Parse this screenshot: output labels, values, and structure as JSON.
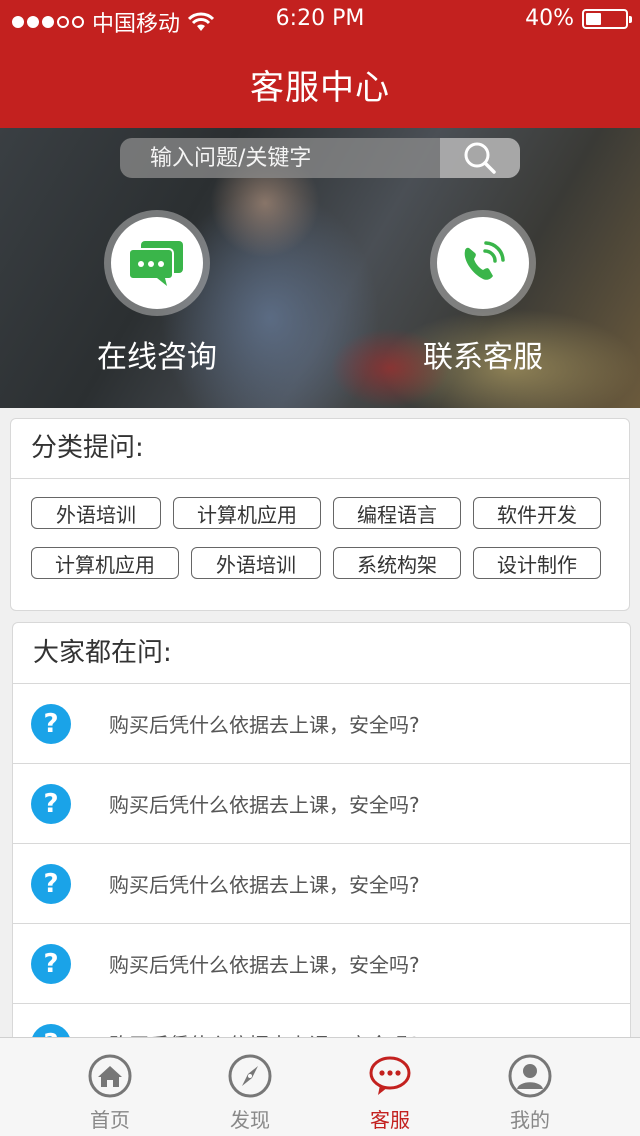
{
  "status_bar": {
    "carrier": "中国移动",
    "time": "6:20 PM",
    "battery_text": "40%",
    "battery_level": 0.4
  },
  "header": {
    "title": "客服中心"
  },
  "search": {
    "placeholder": "输入问题/关键字",
    "icon": "search-icon"
  },
  "actions": [
    {
      "label": "在线咨询",
      "icon": "chat-icon",
      "color": "#3ab54a"
    },
    {
      "label": "联系客服",
      "icon": "phone-icon",
      "color": "#3ab54a"
    }
  ],
  "categories": {
    "title": "分类提问:",
    "rows": [
      [
        "外语培训",
        "计算机应用",
        "编程语言",
        "软件开发"
      ],
      [
        "计算机应用",
        "外语培训",
        "系统构架",
        "设计制作"
      ]
    ]
  },
  "faq": {
    "title": "大家都在问:",
    "items": [
      "购买后凭什么依据去上课，安全吗?",
      "购买后凭什么依据去上课，安全吗?",
      "购买后凭什么依据去上课，安全吗?",
      "购买后凭什么依据去上课，安全吗?",
      "购买后凭什么依据去上课，安全吗?"
    ],
    "icon_color": "#1aa3e8"
  },
  "tabbar": {
    "items": [
      {
        "label": "首页",
        "icon": "home-icon",
        "active": false
      },
      {
        "label": "发现",
        "icon": "compass-icon",
        "active": false
      },
      {
        "label": "客服",
        "icon": "chat-bubble-icon",
        "active": true
      },
      {
        "label": "我的",
        "icon": "user-icon",
        "active": false
      }
    ],
    "active_color": "#c3211f"
  },
  "colors": {
    "brand": "#c3211f",
    "accent_blue": "#1aa3e8",
    "green": "#3ab54a"
  }
}
